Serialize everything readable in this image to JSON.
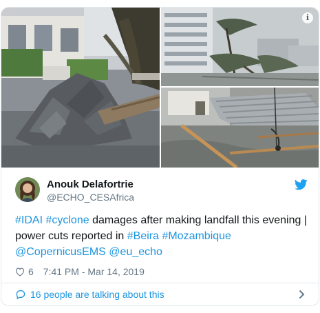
{
  "author": {
    "name": "Anouk Delafortrie",
    "handle": "@ECHO_CESAfrica"
  },
  "tweet": {
    "segments": [
      {
        "text": "#IDAI",
        "link": true
      },
      {
        "text": " ",
        "link": false
      },
      {
        "text": "#cyclone",
        "link": true
      },
      {
        "text": " damages after making landfall this evening | power cuts reported in ",
        "link": false
      },
      {
        "text": "#Beira",
        "link": true
      },
      {
        "text": " ",
        "link": false
      },
      {
        "text": "#Mozambique",
        "link": true
      },
      {
        "text": " ",
        "link": false
      },
      {
        "text": "@CopernicusEMS",
        "link": true
      },
      {
        "text": " ",
        "link": false
      },
      {
        "text": "@eu_echo",
        "link": true
      }
    ]
  },
  "meta": {
    "likes": "6",
    "timestamp": "7:41 PM - Mar 14, 2019"
  },
  "footer": {
    "talking": "16 people are talking about this"
  },
  "media": {
    "info_glyph": "i",
    "photos": [
      {
        "subject": "collapsed-pavement-fallen-tree-photo"
      },
      {
        "subject": "storm-bent-trees-high-rise-photo"
      },
      {
        "subject": "fallen-power-line-metal-roof-photo"
      }
    ]
  },
  "icons": {
    "brand": "twitter-bird-icon",
    "like": "heart-icon",
    "conversation": "speech-bubble-icon",
    "open": "chevron-right-icon",
    "info": "info-icon"
  },
  "colors": {
    "link": "#1b95e0",
    "brand": "#1da1f2",
    "text": "#14171a",
    "secondary": "#657786",
    "border": "#e1e8ed"
  }
}
